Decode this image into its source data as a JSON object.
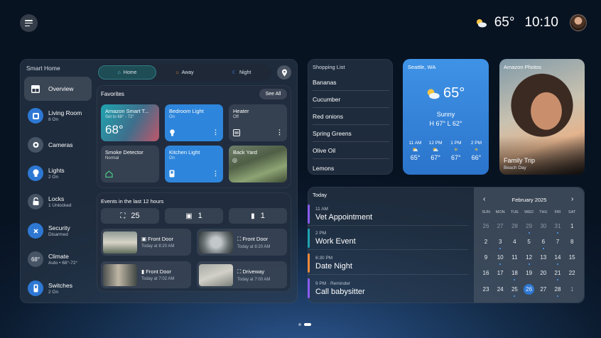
{
  "topbar": {
    "temp": "65°",
    "time": "10:10",
    "weather_icon": "partly-sunny-icon"
  },
  "sidebar": {
    "title": "Smart Home",
    "items": [
      {
        "label": "Overview",
        "sub": ""
      },
      {
        "label": "Living Room",
        "sub": "8 On"
      },
      {
        "label": "Cameras",
        "sub": ""
      },
      {
        "label": "Lights",
        "sub": "2 On"
      },
      {
        "label": "Locks",
        "sub": "1 Unlocked"
      },
      {
        "label": "Security",
        "sub": "Disarmed"
      },
      {
        "label": "Climate",
        "sub": "Auto • 68°-72°",
        "badge": "68°"
      },
      {
        "label": "Switches",
        "sub": "2 On"
      }
    ]
  },
  "modes": [
    {
      "label": "Home"
    },
    {
      "label": "Away"
    },
    {
      "label": "Night"
    }
  ],
  "favorites": {
    "title": "Favorites",
    "see_all": "See All",
    "tiles": [
      {
        "name": "Amazon Smart T...",
        "sub": "Set to 68° - 72°",
        "value": "68°"
      },
      {
        "name": "Bedroom Light",
        "sub": "On"
      },
      {
        "name": "Heater",
        "sub": "Off"
      },
      {
        "name": "Smoke Detector",
        "sub": "Normal"
      },
      {
        "name": "Kitchen Light",
        "sub": "On"
      },
      {
        "name": "Back Yard",
        "sub": ""
      }
    ]
  },
  "events": {
    "title": "Events in the last 12 hours",
    "counts": [
      "25",
      "1",
      "1"
    ],
    "items": [
      {
        "name": "Front Door",
        "time": "Today at 8:20 AM"
      },
      {
        "name": "Front Door",
        "time": "Today at 8:20 AM"
      },
      {
        "name": "Front Door",
        "time": "Today at 7:02 AM"
      },
      {
        "name": "Driveway",
        "time": "Today at 7:00 AM"
      }
    ]
  },
  "shopping": {
    "title": "Shopping List",
    "items": [
      "Bananas",
      "Cucumber",
      "Red onions",
      "Spring Greens",
      "Olive Oil",
      "Lemons"
    ]
  },
  "weather": {
    "city": "Seattle, WA",
    "temp": "65°",
    "condition": "Sunny",
    "hilo": "H 67°  L 62°",
    "hours": [
      {
        "time": "11 AM",
        "temp": "65°"
      },
      {
        "time": "12 PM",
        "temp": "67°"
      },
      {
        "time": "1 PM",
        "temp": "67°"
      },
      {
        "time": "2 PM",
        "temp": "66°"
      }
    ]
  },
  "photos": {
    "source": "Amazon Photos",
    "title": "Family Trip",
    "sub": "Beach Day"
  },
  "agenda": {
    "title": "Today",
    "items": [
      {
        "time": "11 AM",
        "name": "Vet Appointment",
        "color": "#8a5cf0"
      },
      {
        "time": "2 PM",
        "name": "Work Event",
        "color": "#1fa3b0"
      },
      {
        "time": "6:30 PM",
        "name": "Date Night",
        "color": "#f08a3c"
      },
      {
        "time": "9 PM · Reminder",
        "name": "Call babysitter",
        "color": "#8a5cf0"
      }
    ]
  },
  "calendar": {
    "month": "February 2025",
    "weekdays": [
      "SUN",
      "MON",
      "TUE",
      "WED",
      "THU",
      "FRI",
      "SAT"
    ],
    "weeks": [
      [
        "26",
        "27",
        "28",
        "29",
        "30",
        "31",
        "1"
      ],
      [
        "2",
        "3",
        "4",
        "5",
        "6",
        "7",
        "8"
      ],
      [
        "9",
        "10",
        "11",
        "12",
        "13",
        "14",
        "15"
      ],
      [
        "16",
        "17",
        "18",
        "19",
        "20",
        "21",
        "22"
      ],
      [
        "23",
        "24",
        "25",
        "26",
        "27",
        "28",
        "1"
      ]
    ],
    "today": "26"
  }
}
